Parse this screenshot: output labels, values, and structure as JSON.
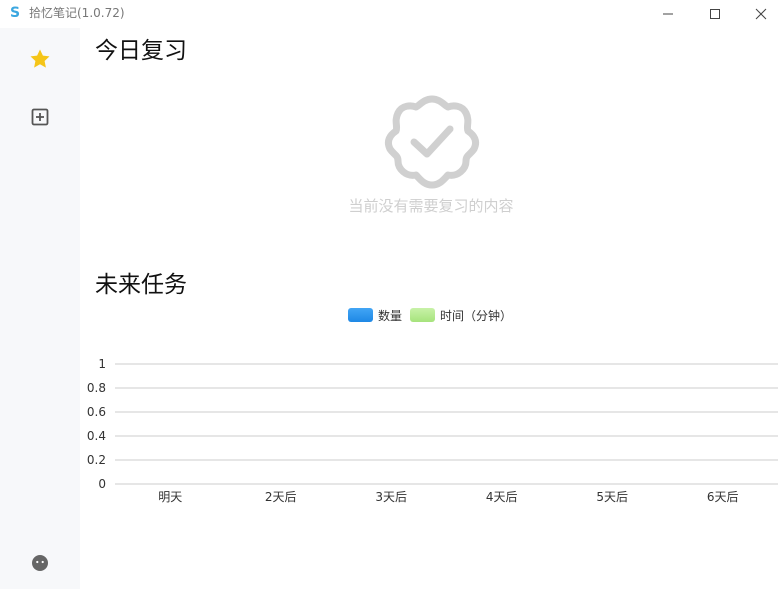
{
  "window": {
    "app_logo": "S",
    "title": "拾忆笔记(1.0.72)"
  },
  "sidebar": {
    "items": [
      {
        "icon": "star-icon",
        "color": "#f5c518"
      },
      {
        "icon": "add-box-icon",
        "color": "#555555"
      },
      {
        "icon": "user-avatar-icon",
        "color": "#666666"
      }
    ]
  },
  "review": {
    "title": "今日复习",
    "empty_icon": "verified-check-icon",
    "empty_text": "当前没有需要复习的内容"
  },
  "future": {
    "title": "未来任务"
  },
  "colors": {
    "count_series": "#1e88e5",
    "time_series": "#b7eb8f",
    "grid": "#cccccc",
    "empty_icon": "#d0d0d0"
  },
  "chart_data": {
    "type": "bar",
    "categories": [
      "明天",
      "2天后",
      "3天后",
      "4天后",
      "5天后",
      "6天后"
    ],
    "series": [
      {
        "name": "数量",
        "values": [
          0,
          0,
          0,
          0,
          0,
          0
        ]
      },
      {
        "name": "时间（分钟）",
        "values": [
          0,
          0,
          0,
          0,
          0,
          0
        ]
      }
    ],
    "y_ticks": [
      "0",
      "0.2",
      "0.4",
      "0.6",
      "0.8",
      "1"
    ],
    "ylim": [
      0,
      1
    ],
    "legend_position": "top-center",
    "grid": true
  }
}
